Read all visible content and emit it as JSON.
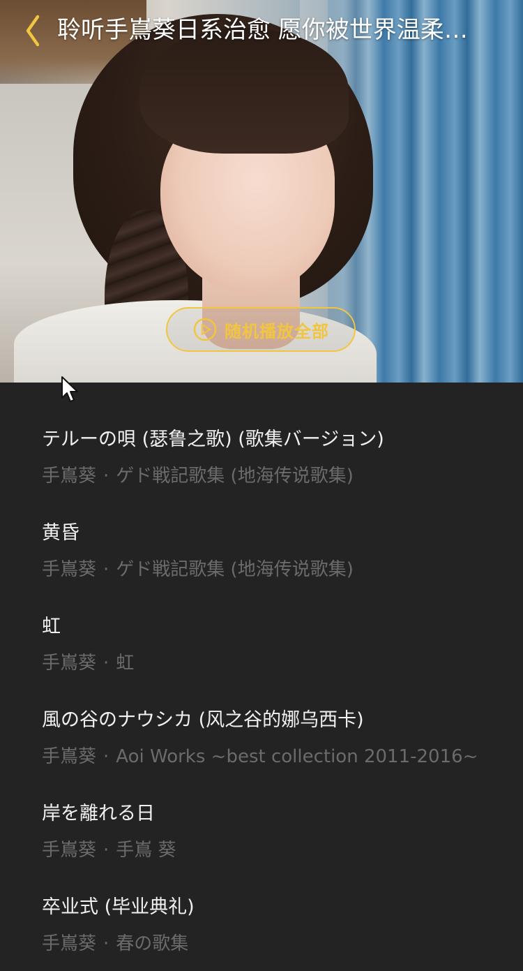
{
  "header": {
    "title": "聆听手嶌葵日系治愈 愿你被世界温柔以待",
    "back_icon": "chevron-left-icon",
    "accent_color": "#f2c541"
  },
  "cover": {
    "shuffle_label": "随机播放全部",
    "shuffle_icon": "play-circle-icon"
  },
  "songs": [
    {
      "title": "テルーの唄 (瑟鲁之歌) (歌集バージョン)",
      "artist": "手嶌葵",
      "separator": "·",
      "album": "ゲド戦記歌集 (地海传说歌集)"
    },
    {
      "title": "黄昏",
      "artist": "手嶌葵",
      "separator": "·",
      "album": "ゲド戦記歌集 (地海传说歌集)"
    },
    {
      "title": "虹",
      "artist": "手嶌葵",
      "separator": "·",
      "album": "虹"
    },
    {
      "title": "風の谷のナウシカ (风之谷的娜乌西卡)",
      "artist": "手嶌葵",
      "separator": "·",
      "album": "Aoi Works ~best collection 2011-2016~"
    },
    {
      "title": "岸を離れる日",
      "artist": "手嶌葵",
      "separator": "·",
      "album": "手嶌 葵"
    },
    {
      "title": "卒业式 (毕业典礼)",
      "artist": "手嶌葵",
      "separator": "·",
      "album": "春の歌集"
    }
  ],
  "colors": {
    "list_background": "#232323",
    "title_text": "#f1f1f1",
    "subtitle_text": "#6b6b6b"
  }
}
